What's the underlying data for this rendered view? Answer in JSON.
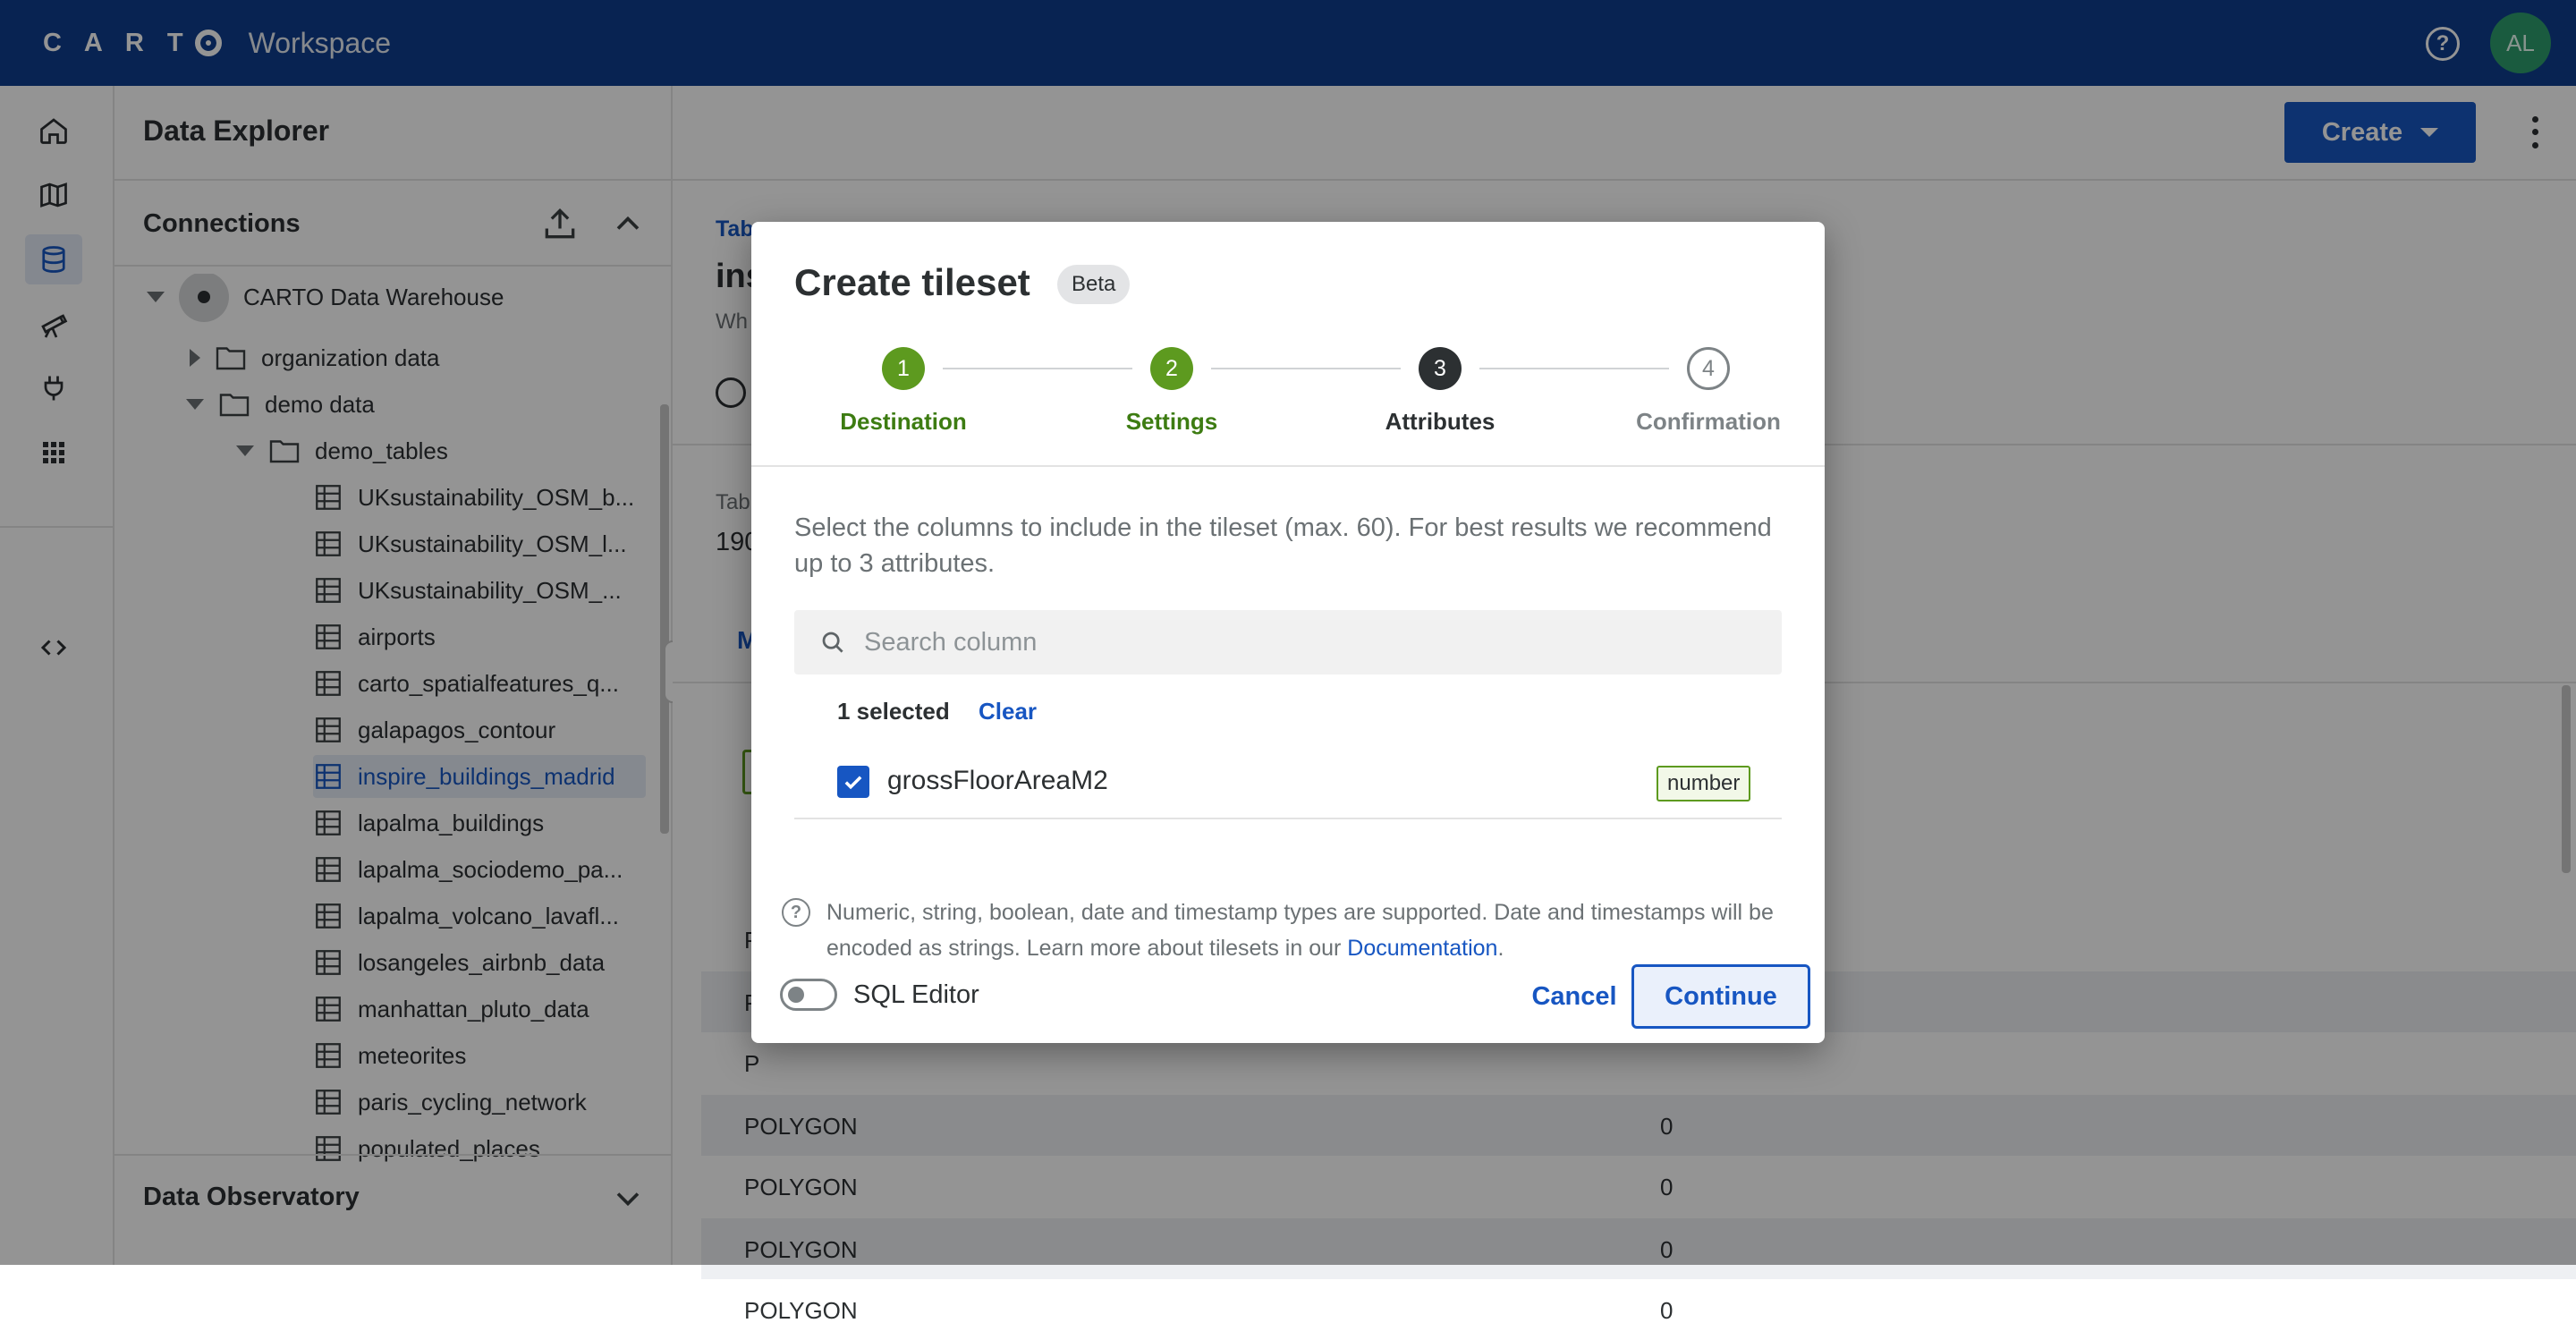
{
  "app": {
    "brand": "CARTO",
    "product": "Workspace",
    "help_icon": "help-circle-icon",
    "avatar_initials": "AL"
  },
  "rail": {
    "items": [
      "home-icon",
      "map-icon",
      "database-icon",
      "telescope-icon",
      "plug-icon",
      "apps-grid-icon",
      "code-icon"
    ]
  },
  "explorer": {
    "title": "Data Explorer",
    "connections_title": "Connections",
    "root": "CARTO Data Warehouse",
    "folders": [
      "organization data",
      "demo data",
      "demo_tables"
    ],
    "tables": [
      "UKsustainability_OSM_b...",
      "UKsustainability_OSM_l...",
      "UKsustainability_OSM_...",
      "airports",
      "carto_spatialfeatures_q...",
      "galapagos_contour",
      "inspire_buildings_madrid",
      "lapalma_buildings",
      "lapalma_sociodemo_pa...",
      "lapalma_volcano_lavafl...",
      "losangeles_airbnb_data",
      "manhattan_pluto_data",
      "meteorites",
      "paris_cycling_network",
      "populated_places"
    ],
    "selected_table": "inspire_buildings_madrid",
    "data_observatory_title": "Data Observatory"
  },
  "main": {
    "create_label": "Create",
    "bg_fragments": {
      "tab_label": "Tab",
      "table_name": "ins",
      "subtitle": "Wh",
      "tab_label2": "Tab",
      "count": "190",
      "tab_m": "M"
    },
    "rows": [
      {
        "geom": "P",
        "value": ""
      },
      {
        "geom": "P",
        "value": ""
      },
      {
        "geom": "P",
        "value": ""
      },
      {
        "geom": "POLYGON",
        "value": "0"
      },
      {
        "geom": "POLYGON",
        "value": "0"
      },
      {
        "geom": "POLYGON",
        "value": "0"
      },
      {
        "geom": "POLYGON",
        "value": "0"
      }
    ]
  },
  "dialog": {
    "title": "Create tileset",
    "badge": "Beta",
    "steps": [
      {
        "number": "1",
        "label": "Destination",
        "state": "done"
      },
      {
        "number": "2",
        "label": "Settings",
        "state": "done"
      },
      {
        "number": "3",
        "label": "Attributes",
        "state": "current"
      },
      {
        "number": "4",
        "label": "Confirmation",
        "state": "todo"
      }
    ],
    "description": "Select the columns to include in the tileset (max. 60). For best results we recommend up to 3 attributes.",
    "search_placeholder": "Search column",
    "selected_count": "1 selected",
    "clear_label": "Clear",
    "columns": [
      {
        "name": "grossFloorAreaM2",
        "type": "number",
        "checked": true
      }
    ],
    "note_text": "Numeric, string, boolean, date and timestamp types are supported. Date and timestamps will be encoded as strings. Learn more about tilesets in our ",
    "note_link": "Documentation",
    "note_end": ".",
    "sql_editor_label": "SQL Editor",
    "sql_editor_on": false,
    "cancel_label": "Cancel",
    "continue_label": "Continue"
  },
  "colors": {
    "topbar": "#0e3d8e",
    "primary": "#1756c2",
    "step_done": "#5d9a1f",
    "step_current": "#2c3032"
  }
}
